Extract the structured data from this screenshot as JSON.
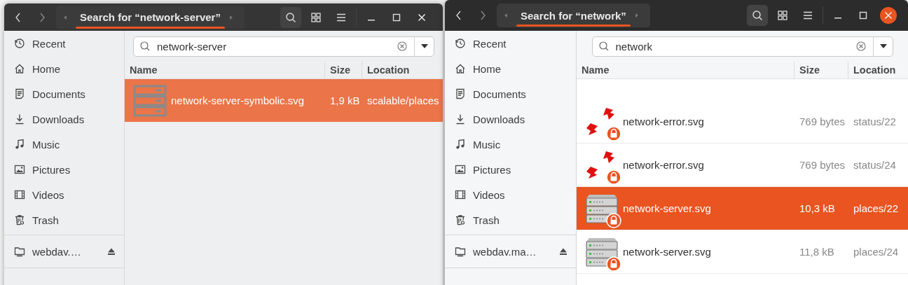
{
  "windows": [
    {
      "title": "Search for “network-server”",
      "active": false,
      "search_toggled": true,
      "places": [
        {
          "label": "Recent",
          "kind": "recent"
        },
        {
          "label": "Home",
          "kind": "home"
        },
        {
          "label": "Documents",
          "kind": "documents"
        },
        {
          "label": "Downloads",
          "kind": "downloads"
        },
        {
          "label": "Music",
          "kind": "music"
        },
        {
          "label": "Pictures",
          "kind": "pictures"
        },
        {
          "label": "Videos",
          "kind": "videos"
        },
        {
          "label": "Trash",
          "kind": "trash"
        }
      ],
      "mounts": [
        {
          "label": "webdav.…",
          "eject": true
        }
      ],
      "search": {
        "value": "network-server"
      },
      "columns": [
        "Name",
        "Size",
        "Location"
      ],
      "rows": [
        {
          "name": "network-server-symbolic.svg",
          "size": "1,9 kB",
          "location": "scalable/places",
          "kind": "server-outline",
          "locked": false,
          "selected": true
        }
      ]
    },
    {
      "title": "Search for “network”",
      "active": true,
      "search_toggled": true,
      "places": [
        {
          "label": "Recent",
          "kind": "recent"
        },
        {
          "label": "Home",
          "kind": "home"
        },
        {
          "label": "Documents",
          "kind": "documents"
        },
        {
          "label": "Downloads",
          "kind": "downloads"
        },
        {
          "label": "Music",
          "kind": "music"
        },
        {
          "label": "Pictures",
          "kind": "pictures"
        },
        {
          "label": "Videos",
          "kind": "videos"
        },
        {
          "label": "Trash",
          "kind": "trash"
        }
      ],
      "mounts": [
        {
          "label": "webdav.ma…",
          "eject": true
        }
      ],
      "search": {
        "value": "network"
      },
      "columns": [
        "Name",
        "Size",
        "Location"
      ],
      "rows": [
        {
          "name": "network-error.svg",
          "size": "769 bytes",
          "location": "status/22",
          "kind": "error",
          "locked": true,
          "selected": false
        },
        {
          "name": "network-error.svg",
          "size": "769 bytes",
          "location": "status/24",
          "kind": "error",
          "locked": true,
          "selected": false
        },
        {
          "name": "network-server.svg",
          "size": "10,3 kB",
          "location": "places/22",
          "kind": "server",
          "locked": true,
          "selected": true
        },
        {
          "name": "network-server.svg",
          "size": "11,8 kB",
          "location": "places/24",
          "kind": "server",
          "locked": true,
          "selected": false
        }
      ]
    }
  ]
}
